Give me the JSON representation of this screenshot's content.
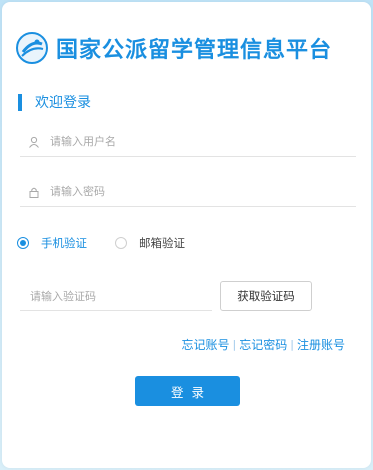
{
  "header": {
    "site_title": "国家公派留学管理信息平台"
  },
  "login": {
    "welcome": "欢迎登录",
    "username_placeholder": "请输入用户名",
    "password_placeholder": "请输入密码",
    "verify_options": [
      {
        "label": "手机验证",
        "checked": true
      },
      {
        "label": "邮箱验证",
        "checked": false
      }
    ],
    "code_placeholder": "请输入验证码",
    "get_code_label": "获取验证码",
    "links": {
      "forgot_account": "忘记账号",
      "forgot_password": "忘记密码",
      "register": "注册账号",
      "separator": "|"
    },
    "submit_label": "登录"
  },
  "colors": {
    "accent": "#1a8fe0",
    "background": "#c6e6f8"
  },
  "icons": {
    "username": "user-icon",
    "password": "lock-icon",
    "logo": "site-logo-icon"
  }
}
